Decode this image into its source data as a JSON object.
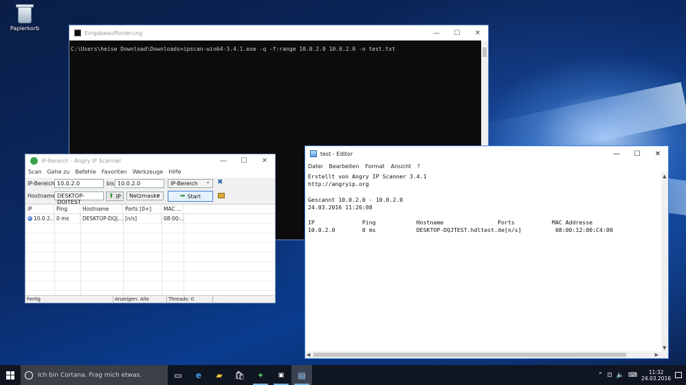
{
  "desktop": {
    "icons": [
      {
        "label": "Papierkorb",
        "icon": "recycle-bin-icon"
      }
    ]
  },
  "cmd_window": {
    "title": "Eingabeaufforderung",
    "console_text": "C:\\Users\\heise Download\\Downloads>ipscan-win64-3.4.1.exe -q -f:range 10.0.2.0 10.0.2.0 -o test.txt",
    "controls": {
      "minimize": "—",
      "maximize": "☐",
      "close": "✕"
    }
  },
  "ipscanner_window": {
    "title": "IP-Bereich - Angry IP Scanner",
    "menu": [
      "Scan",
      "Gehe zu",
      "Befehle",
      "Favoriten",
      "Werkzeuge",
      "Hilfe"
    ],
    "form": {
      "range_label": "IP-Bereich:",
      "range_start": "10.0.2.0",
      "bis_label": "bis",
      "range_end": "10.0.2.0",
      "mode_select": "IP-Bereich",
      "hostname_label": "Hostname:",
      "hostname_value": "DESKTOP-DQJTEST",
      "ip_button": "IP",
      "netmask_select": "Netzmaske",
      "start_button": "Start"
    },
    "columns": [
      "IP",
      "Ping",
      "Hostname",
      "Ports [0+]",
      "MAC ..."
    ],
    "rows": [
      {
        "ip": "10.0.2...",
        "ping": "0 ms",
        "hostname": "DESKTOP-DQJ...",
        "ports": "[n/s]",
        "mac": "08:00:..."
      }
    ],
    "status": {
      "state": "Fertig",
      "display": "Anzeigen: Alle",
      "threads": "Threads: 0"
    }
  },
  "editor_window": {
    "title": "test - Editor",
    "menu": [
      "Datei",
      "Bearbeiten",
      "Format",
      "Ansicht",
      "?"
    ],
    "content_lines": [
      "Erstellt von Angry IP Scanner 3.4.1",
      "http://angryip.org",
      "",
      "Gescannt 10.0.2.0 - 10.0.2.0",
      "24.03.2016 11:26:08",
      "",
      "IP              Ping            Hostname                Ports           MAC Addresse",
      "10.0.2.0        0 ms            DESKTOP-DQJTEST.hdltest.de[n/s]          08:00:12:00:C4:00"
    ]
  },
  "taskbar": {
    "search_placeholder": "Ich bin Cortana. Frag mich etwas.",
    "apps": [
      "task-view-icon",
      "edge-icon",
      "explorer-icon",
      "store-icon",
      "angry-ip-icon",
      "cmd-icon",
      "notepad-icon"
    ],
    "tray": {
      "time": "11:32",
      "date": "24.03.2016"
    }
  }
}
